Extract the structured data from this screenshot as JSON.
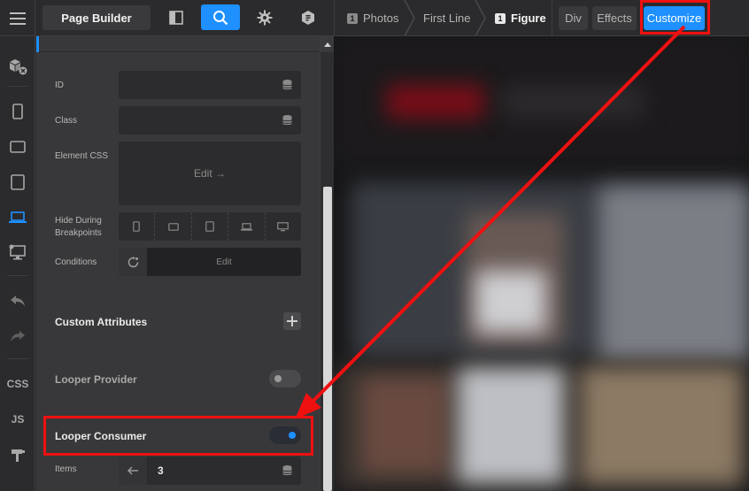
{
  "topbar": {
    "page_builder_label": "Page Builder",
    "breadcrumbs": [
      {
        "num": "1",
        "label": "Photos"
      },
      {
        "label": "First Line"
      },
      {
        "num": "1",
        "label": "Figure"
      }
    ],
    "tabs": [
      "Div",
      "Effects",
      "Customize"
    ],
    "active_tab": "Customize"
  },
  "rail": {
    "css_label": "CSS",
    "js_label": "JS"
  },
  "panel": {
    "id_label": "ID",
    "class_label": "Class",
    "element_css_label": "Element CSS",
    "element_css_edit": "Edit →",
    "hide_breakpoints_label_1": "Hide During",
    "hide_breakpoints_label_2": "Breakpoints",
    "conditions_label": "Conditions",
    "conditions_edit": "Edit",
    "custom_attributes_label": "Custom Attributes",
    "looper_provider_label": "Looper Provider",
    "looper_provider_on": false,
    "looper_consumer_label": "Looper Consumer",
    "looper_consumer_on": true,
    "items_label": "Items",
    "items_value": "3"
  },
  "colors": {
    "accent": "#1e90ff",
    "annotation": "#ef1010",
    "panel_bg": "#38383a",
    "bar_bg": "#2b2b2d"
  }
}
